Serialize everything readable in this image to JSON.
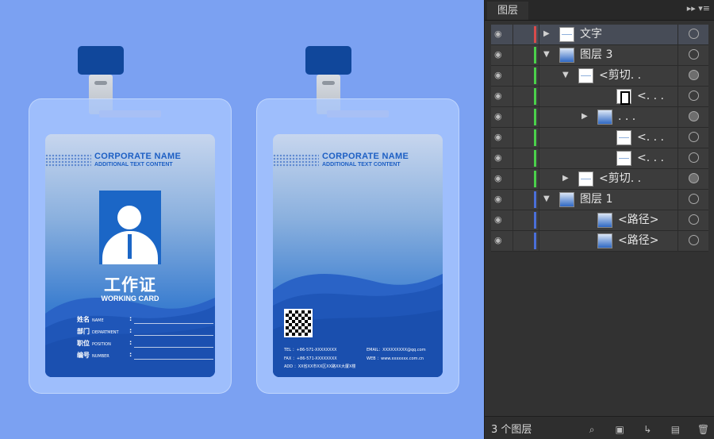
{
  "badges": [
    {
      "corp_name": "CORPORATE NAME",
      "corp_sub": "ADDITIONAL TEXT CONTENT",
      "title_cn": "工作证",
      "title_en": "WORKING CARD",
      "fields": [
        {
          "cn": "姓名",
          "en": "NAME",
          "colon": ":"
        },
        {
          "cn": "部门",
          "en": "DEPARTMENT",
          "colon": ":"
        },
        {
          "cn": "职位",
          "en": "POSITION",
          "colon": ":"
        },
        {
          "cn": "编号",
          "en": "NUMBER",
          "colon": ":"
        }
      ]
    },
    {
      "corp_name": "CORPORATE NAME",
      "corp_sub": "ADDITIONAL TEXT CONTENT",
      "tel": "TEL ：+86-571-XXXXXXXX",
      "fax": "FAX ：+86-571-XXXXXXXX",
      "add": "ADD ：XX省XX市XX区XX路XX大厦X楼",
      "email": "EMAIL：XXXXXXXXX@qq.com",
      "web": "WEB ：www.xxxxxxx.com.cn"
    }
  ],
  "panel": {
    "tab": "图层",
    "tab_tools": "▸▸  ▾≡",
    "layers": [
      {
        "name": "文字",
        "expanded": false,
        "color": "#d84b4b",
        "selected": true,
        "target_filled": false
      },
      {
        "name": "图层 3",
        "expanded": true,
        "color": "#4bd04b",
        "selected": false,
        "target_filled": false
      },
      {
        "name": "<剪切. .",
        "expanded": true,
        "color": "#4bd04b",
        "selected": false,
        "target_filled": true
      },
      {
        "name": "<. . .",
        "expanded": null,
        "color": "#4bd04b",
        "selected": false,
        "target_filled": false
      },
      {
        "name": ". . .",
        "expanded": false,
        "color": "#4bd04b",
        "selected": false,
        "target_filled": true
      },
      {
        "name": "<. . .",
        "expanded": null,
        "color": "#4bd04b",
        "selected": false,
        "target_filled": false
      },
      {
        "name": "<. . .",
        "expanded": null,
        "color": "#4bd04b",
        "selected": false,
        "target_filled": false
      },
      {
        "name": "<剪切. .",
        "expanded": false,
        "color": "#4bd04b",
        "selected": false,
        "target_filled": true
      },
      {
        "name": "图层 1",
        "expanded": true,
        "color": "#4a6fd8",
        "selected": false,
        "target_filled": false
      },
      {
        "name": "<路径>",
        "expanded": null,
        "color": "#4a6fd8",
        "selected": false,
        "target_filled": false
      },
      {
        "name": "<路径>",
        "expanded": null,
        "color": "#4a6fd8",
        "selected": false,
        "target_filled": false
      }
    ],
    "layer_count": "3 个图层",
    "bottom_icons": [
      "locate-object-icon",
      "make-clip-mask-icon",
      "new-sublayer-icon",
      "new-layer-icon",
      "trash-icon"
    ]
  }
}
